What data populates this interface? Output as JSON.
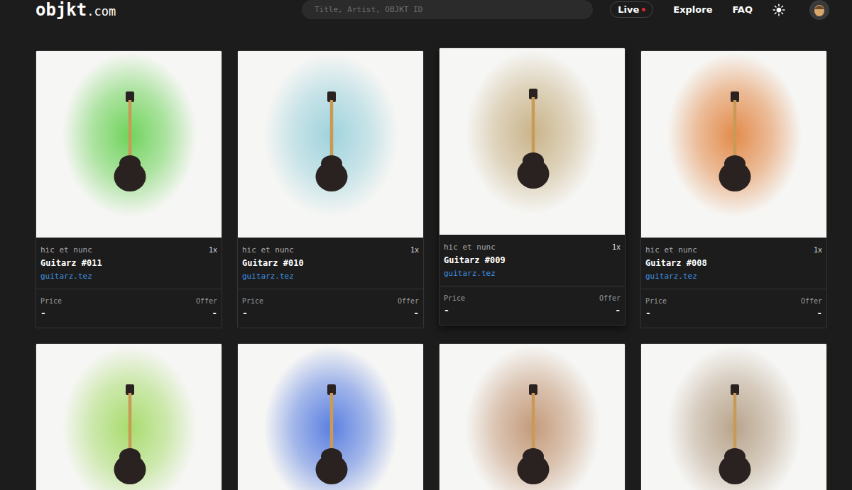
{
  "header": {
    "logo": {
      "name": "objkt",
      "suffix": ".com"
    },
    "search": {
      "placeholder": "Title, Artist, OBJKT ID"
    },
    "nav": [
      {
        "label": "Live",
        "live": true
      },
      {
        "label": "Explore",
        "live": false
      },
      {
        "label": "FAQ",
        "live": false
      }
    ]
  },
  "cards": [
    {
      "platform": "hic et nunc",
      "editions": "1x",
      "title": "Guitarz #011",
      "artist": "guitarz.tez",
      "price_label": "Price",
      "price": "-",
      "offer_label": "Offer",
      "offer": "-",
      "hovered": false,
      "color": "#6fd35b"
    },
    {
      "platform": "hic et nunc",
      "editions": "1x",
      "title": "Guitarz #010",
      "artist": "guitarz.tez",
      "price_label": "Price",
      "price": "-",
      "offer_label": "Offer",
      "offer": "-",
      "hovered": false,
      "color": "#9fd3dd"
    },
    {
      "platform": "hic et nunc",
      "editions": "1x",
      "title": "Guitarz #009",
      "artist": "guitarz.tez",
      "price_label": "Price",
      "price": "-",
      "offer_label": "Offer",
      "offer": "-",
      "hovered": true,
      "color": "#c9b48a"
    },
    {
      "platform": "hic et nunc",
      "editions": "1x",
      "title": "Guitarz #008",
      "artist": "guitarz.tez",
      "price_label": "Price",
      "price": "-",
      "offer_label": "Offer",
      "offer": "-",
      "hovered": false,
      "color": "#e38b4b"
    },
    {
      "hovered": false,
      "color": "#a8dc6e"
    },
    {
      "hovered": false,
      "color": "#5a7fe0"
    },
    {
      "hovered": false,
      "color": "#c49a7a"
    },
    {
      "hovered": false,
      "color": "#b8a48c"
    }
  ]
}
